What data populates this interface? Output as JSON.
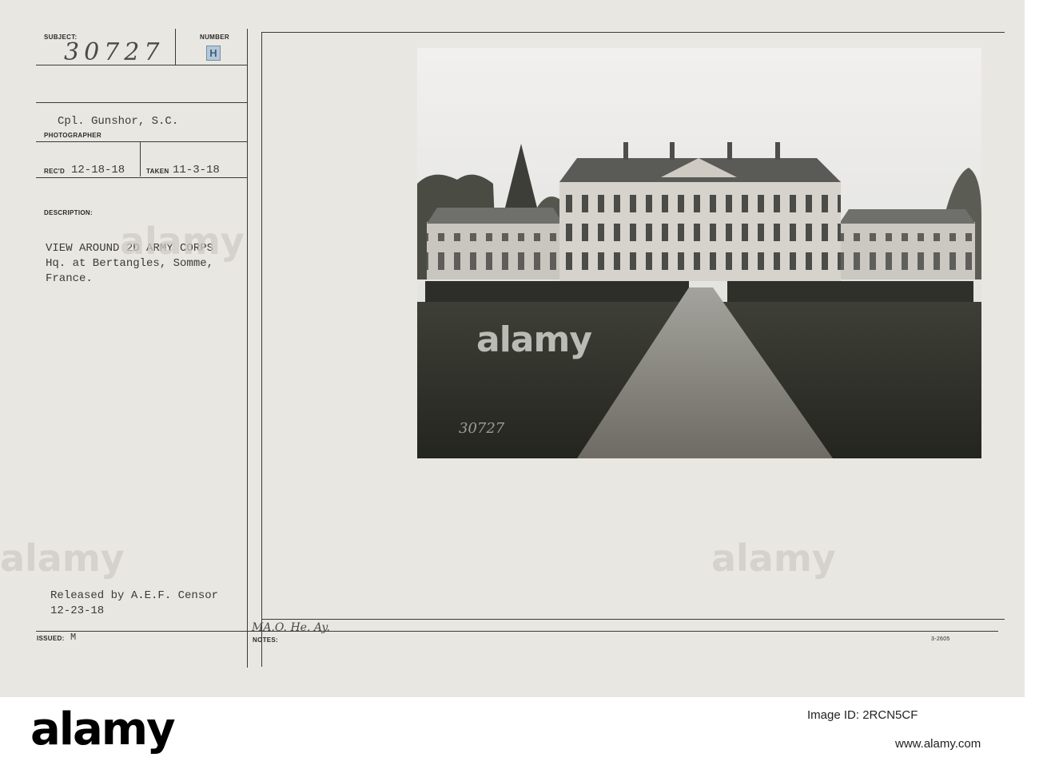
{
  "form": {
    "subject_label": "SUBJECT:",
    "subject_value": "30727",
    "number_label": "NUMBER",
    "number_value": "H",
    "photographer_value": "Cpl. Gunshor, S.C.",
    "photographer_label": "PHOTOGRAPHER",
    "recd_label": "REC'D",
    "recd_value": "12-18-18",
    "taken_label": "TAKEN",
    "taken_value": "11-3-18",
    "description_label": "DESCRIPTION:",
    "description_lines": [
      "VIEW AROUND 2D ARMY CORPS",
      "Hq. at Bertangles, Somme,",
      "France."
    ],
    "released_lines": [
      "Released by A.E.F. Censor",
      "12-23-18"
    ],
    "issued_label": "ISSUED:",
    "issued_value": "M",
    "notes_label": "NOTES:",
    "notes_handwritten": "MA.O. He. Ay.",
    "form_code": "3-2605"
  },
  "photo": {
    "handwritten_number": "30727"
  },
  "watermarks": {
    "brand": "alamy",
    "image_id": "2RCN5CF",
    "site": "www.alamy.com"
  }
}
